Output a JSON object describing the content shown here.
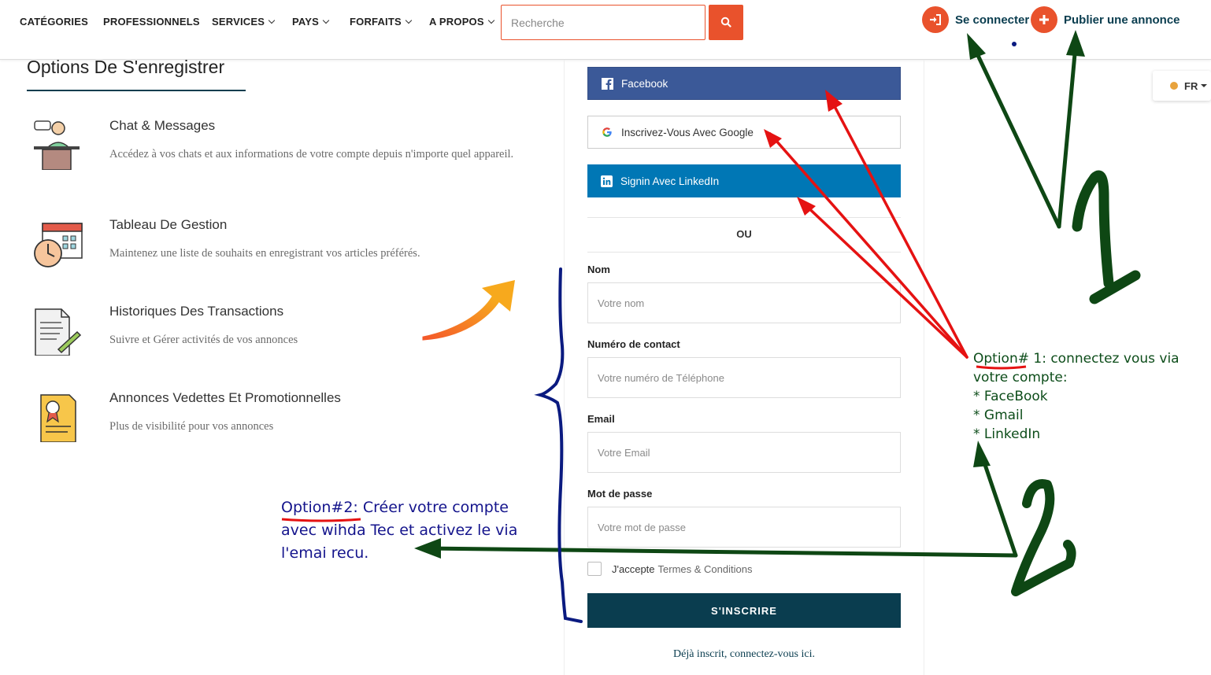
{
  "nav": {
    "items": [
      {
        "label": "CATÉGORIES",
        "has_caret": false
      },
      {
        "label": "PROFESSIONNELS",
        "has_caret": false
      },
      {
        "label": "SERVICES",
        "has_caret": true
      },
      {
        "label": "PAYS",
        "has_caret": true
      },
      {
        "label": "FORFAITS",
        "has_caret": true
      },
      {
        "label": "A PROPOS",
        "has_caret": true
      }
    ],
    "search_placeholder": "Recherche",
    "login_label": "Se connecter",
    "publish_label": "Publier une annonce",
    "language": "FR",
    "accent_color": "#e9522c",
    "brand_color": "#0a3d4f"
  },
  "left": {
    "title": "Options De S'enregistrer",
    "features": [
      {
        "icon": "chat-desk-icon",
        "title": "Chat & Messages",
        "desc": "Accédez à vos chats et aux informations de votre compte depuis n'importe quel appareil."
      },
      {
        "icon": "calendar-clock-icon",
        "title": "Tableau De Gestion",
        "desc": "Maintenez une liste de souhaits en enregistrant vos articles préférés."
      },
      {
        "icon": "document-pen-icon",
        "title": "Historiques Des Transactions",
        "desc": "Suivre et Gérer activités de vos annonces"
      },
      {
        "icon": "certificate-icon",
        "title": "Annonces Vedettes Et Promotionnelles",
        "desc": "Plus de visibilité pour vos annonces"
      }
    ]
  },
  "form": {
    "facebook_label": "Facebook",
    "google_label": "Inscrivez-Vous Avec Google",
    "linkedin_label": "Signin Avec LinkedIn",
    "separator": "OU",
    "name_label": "Nom",
    "name_placeholder": "Votre nom",
    "phone_label": "Numéro de contact",
    "phone_placeholder": "Votre numéro de Téléphone",
    "email_label": "Email",
    "email_placeholder": "Votre Email",
    "password_label": "Mot de passe",
    "password_placeholder": "Votre mot de passe",
    "terms_prefix": "J'accepte",
    "terms_link": "Termes & Conditions",
    "submit_label": "S'INSCRIRE",
    "already_label": "Déjà inscrit, connectez-vous ici."
  },
  "annotations": {
    "note1_title": "Option# 1",
    "note1_rest": ":  connectez vous via votre compte:",
    "note1_items": [
      "* FaceBook",
      "* Gmail",
      "* LinkedIn"
    ],
    "note2_title": "Option#2",
    "note2_rest": ": Créer votre compte avec wihda Tec et activez le via l'emai recu."
  }
}
